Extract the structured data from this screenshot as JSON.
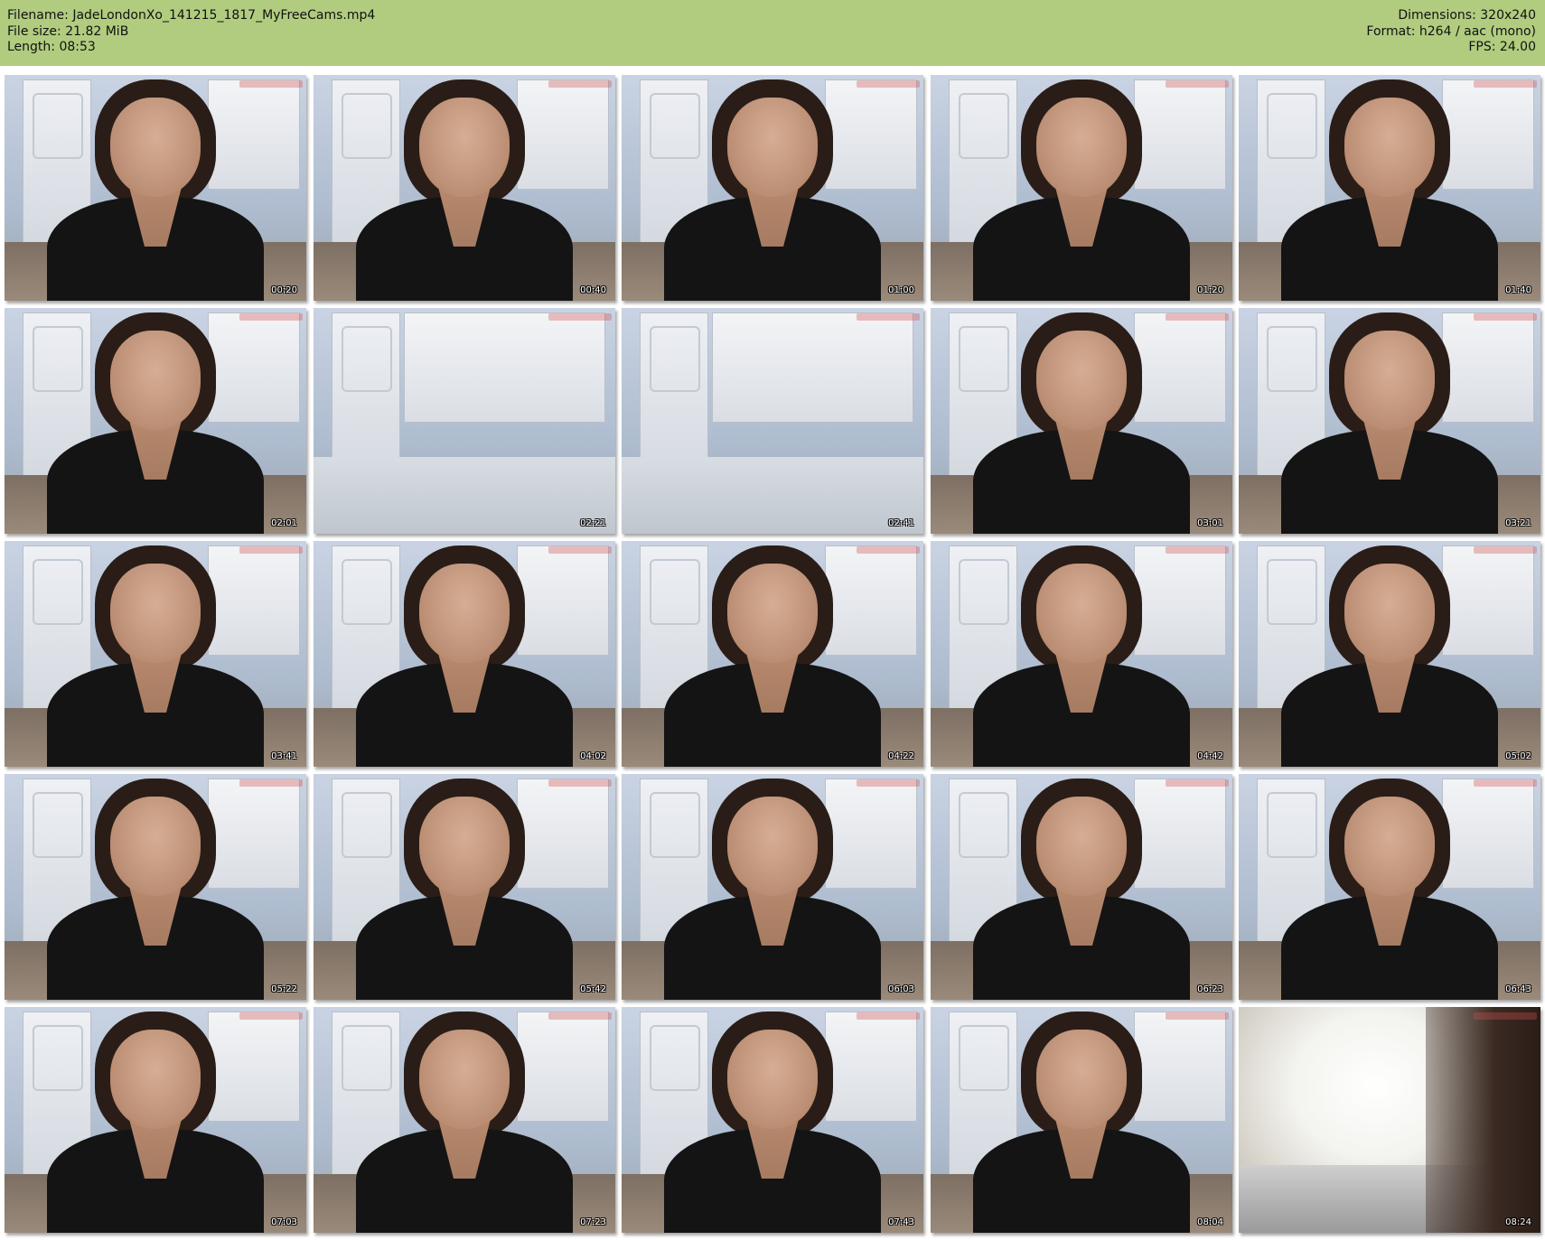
{
  "header": {
    "filename_label": "Filename:",
    "filename": "JadeLondonXo_141215_1817_MyFreeCams.mp4",
    "filesize_label": "File size:",
    "filesize": "21.82 MiB",
    "length_label": "Length:",
    "length": "08:53",
    "dimensions_label": "Dimensions:",
    "dimensions": "320x240",
    "format_label": "Format:",
    "format": "h264 / aac (mono)",
    "fps_label": "FPS:",
    "fps": "24.00",
    "background_color": "#b1cc7f"
  },
  "thumbnails": [
    {
      "timestamp": "00:20",
      "scene": "person"
    },
    {
      "timestamp": "00:40",
      "scene": "person"
    },
    {
      "timestamp": "01:00",
      "scene": "person"
    },
    {
      "timestamp": "01:20",
      "scene": "person"
    },
    {
      "timestamp": "01:40",
      "scene": "person"
    },
    {
      "timestamp": "02:01",
      "scene": "person"
    },
    {
      "timestamp": "02:21",
      "scene": "kitchen"
    },
    {
      "timestamp": "02:41",
      "scene": "kitchen"
    },
    {
      "timestamp": "03:01",
      "scene": "person"
    },
    {
      "timestamp": "03:21",
      "scene": "person"
    },
    {
      "timestamp": "03:41",
      "scene": "person"
    },
    {
      "timestamp": "04:02",
      "scene": "person"
    },
    {
      "timestamp": "04:22",
      "scene": "person"
    },
    {
      "timestamp": "04:42",
      "scene": "person"
    },
    {
      "timestamp": "05:02",
      "scene": "person"
    },
    {
      "timestamp": "05:22",
      "scene": "person"
    },
    {
      "timestamp": "05:42",
      "scene": "person"
    },
    {
      "timestamp": "06:03",
      "scene": "person"
    },
    {
      "timestamp": "06:23",
      "scene": "person"
    },
    {
      "timestamp": "06:43",
      "scene": "person"
    },
    {
      "timestamp": "07:03",
      "scene": "person"
    },
    {
      "timestamp": "07:23",
      "scene": "person"
    },
    {
      "timestamp": "07:43",
      "scene": "person"
    },
    {
      "timestamp": "08:04",
      "scene": "person"
    },
    {
      "timestamp": "08:24",
      "scene": "bright"
    }
  ]
}
